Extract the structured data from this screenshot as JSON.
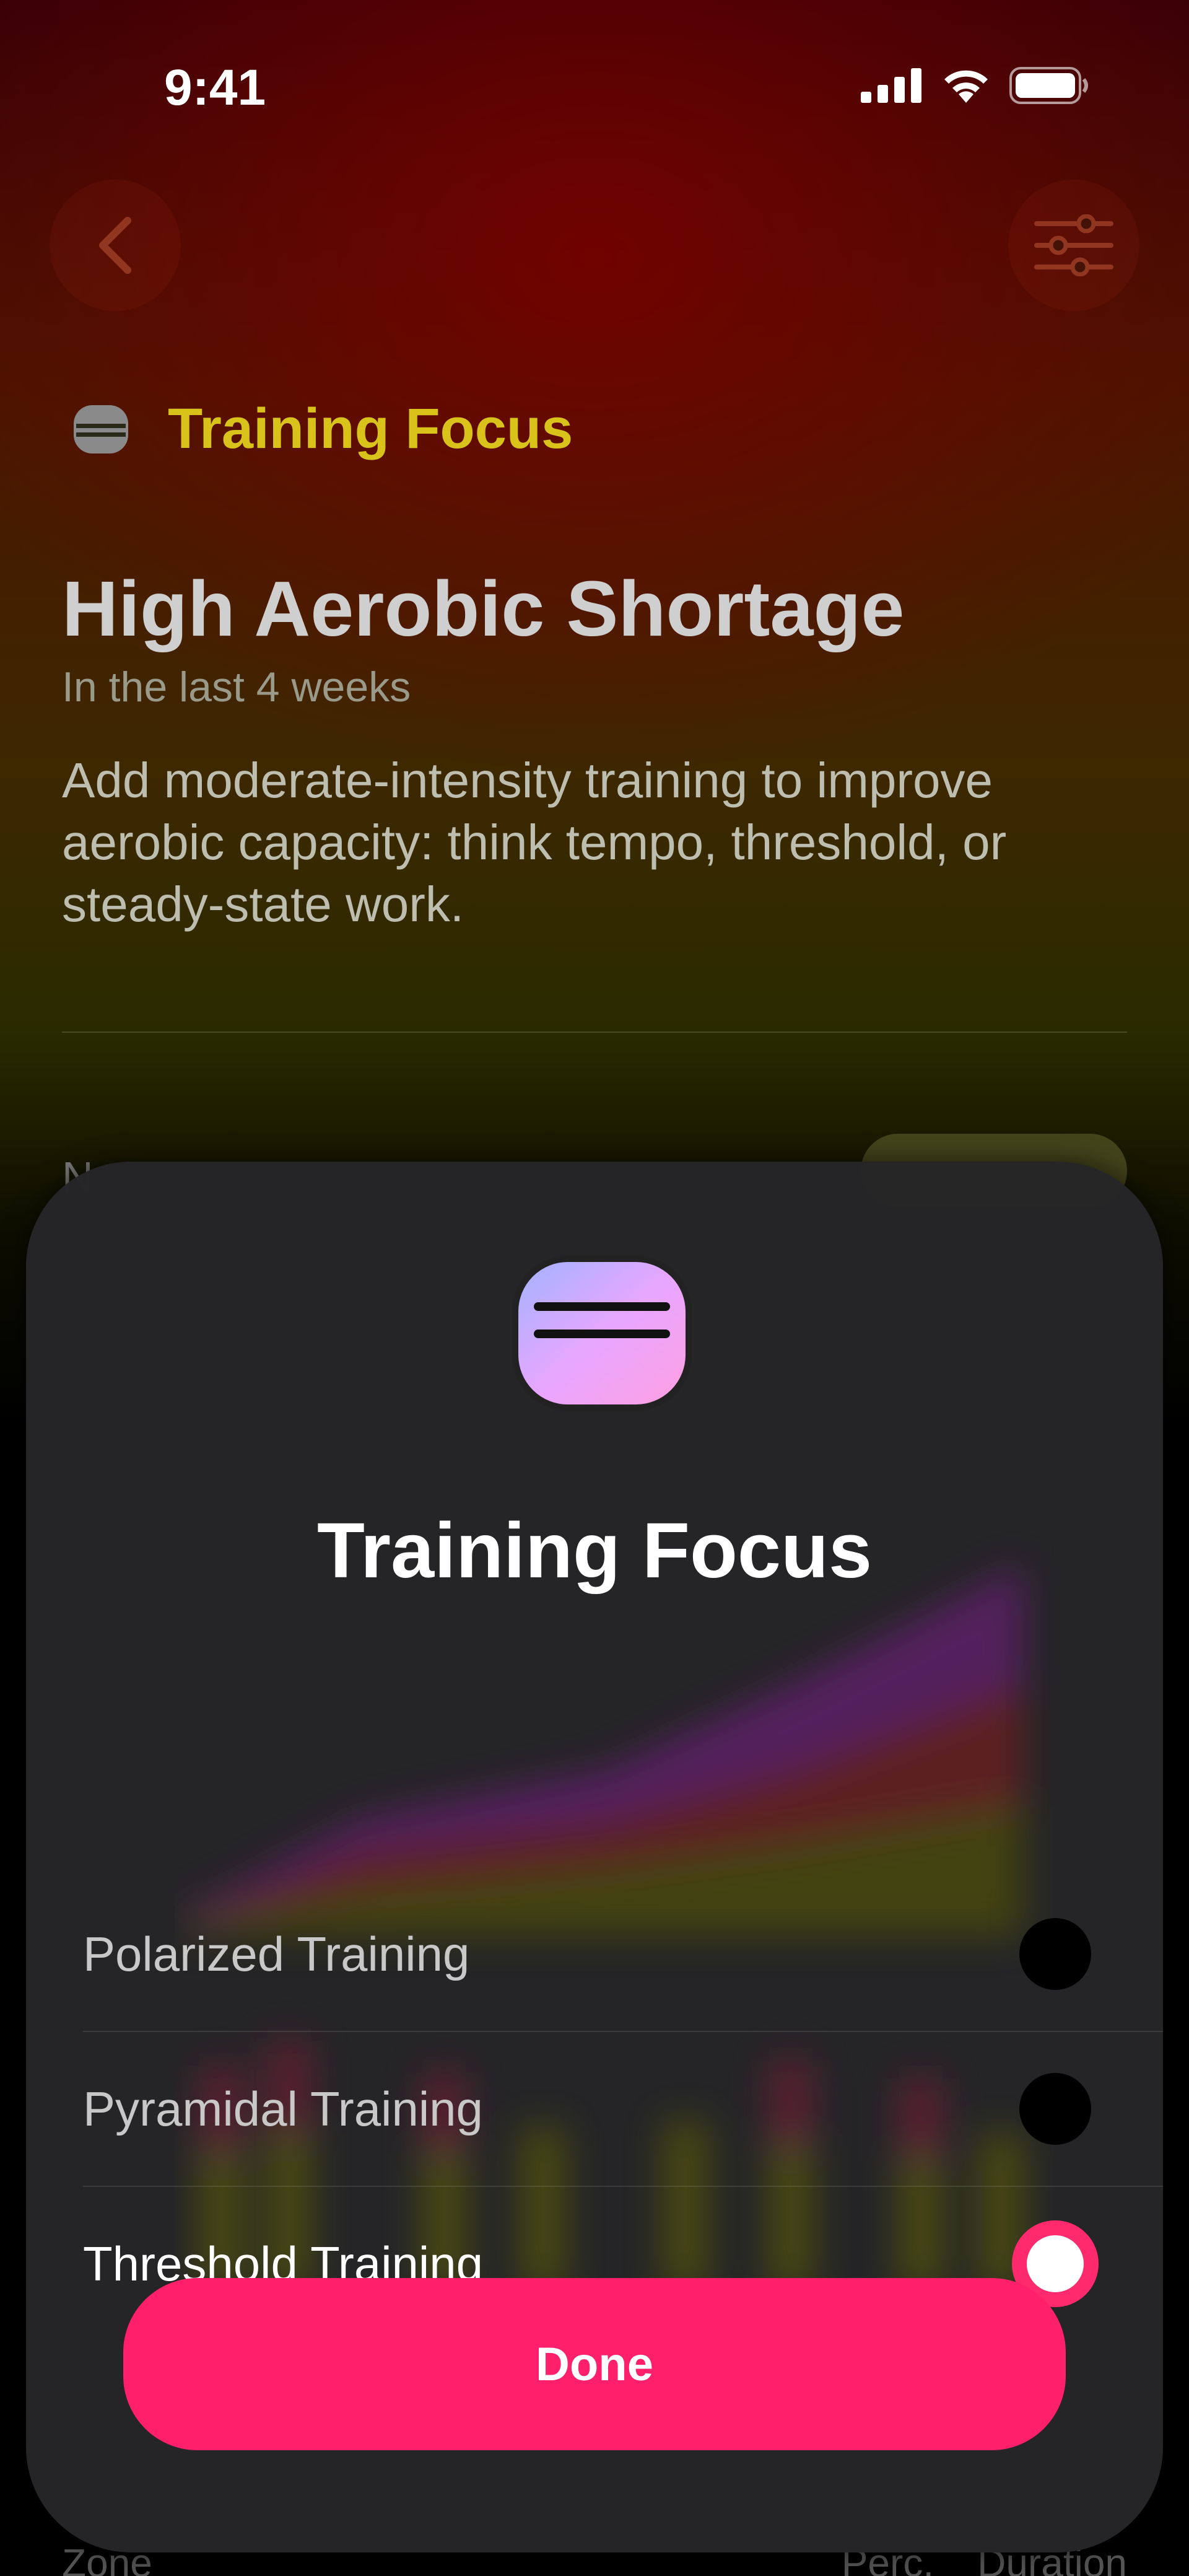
{
  "status_bar": {
    "time": "9:41",
    "icons": [
      "cellular-signal-icon",
      "wifi-icon",
      "battery-icon"
    ]
  },
  "nav": {
    "back_icon": "chevron-left-icon",
    "filter_icon": "sliders-icon"
  },
  "background": {
    "section_icon": "training-focus-icon",
    "section_title": "Training Focus",
    "headline": "High Aerobic Shortage",
    "subheadline": "In the last 4 weeks",
    "description": "Add moderate-intensity training to improve aerobic capacity: think tempo, threshold, or steady-state work.",
    "peek_label": "N",
    "footer_left": "Zone",
    "footer_right_1": "Perc.",
    "footer_right_2": "Duration"
  },
  "sheet": {
    "icon": "training-focus-icon",
    "title": "Training Focus",
    "options": [
      {
        "label": "Polarized Training",
        "selected": false
      },
      {
        "label": "Pyramidal Training",
        "selected": false
      },
      {
        "label": "Threshold Training",
        "selected": true
      }
    ],
    "done_label": "Done"
  },
  "colors": {
    "accent": "#ff1f6b",
    "section_title": "#d9c21a",
    "sheet_bg": "#262628"
  }
}
